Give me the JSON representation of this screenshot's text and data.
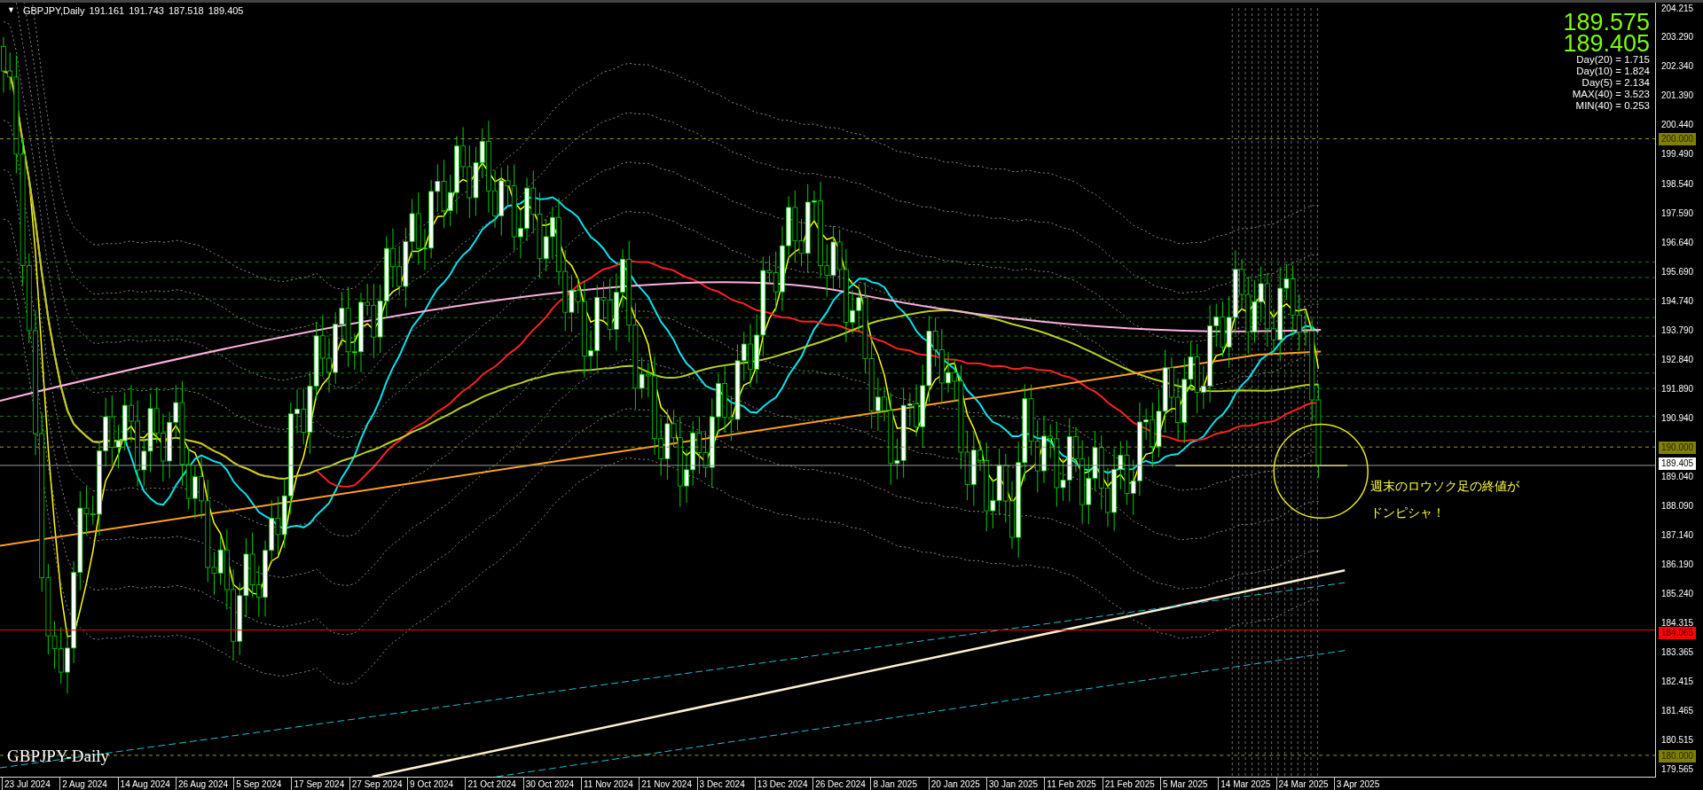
{
  "symbol_header": {
    "menu_glyph": "▼",
    "title": "GBPJPY,Daily",
    "ohlc": [
      "191.161",
      "191.743",
      "187.518",
      "189.405"
    ]
  },
  "quote_panel": {
    "prices": [
      "189.575",
      "189.405"
    ],
    "stats": [
      "Day(20) = 1.715",
      "Day(10) = 1.824",
      "Day(5) = 2.134",
      "MAX(40) = 3.523",
      "MIN(40) = 0.253"
    ]
  },
  "price_axis": {
    "ticks": [
      "204.215",
      "203.290",
      "202.340",
      "201.390",
      "200.440",
      "199.490",
      "198.540",
      "197.590",
      "196.640",
      "195.690",
      "194.740",
      "193.790",
      "192.840",
      "191.890",
      "190.940",
      "189.040",
      "188.090",
      "187.140",
      "186.190",
      "185.240",
      "184.315",
      "183.365",
      "182.415",
      "181.465",
      "180.515",
      "179.565"
    ],
    "level_tags": [
      {
        "label": "200.000",
        "kind": "level"
      },
      {
        "label": "190.000",
        "kind": "level"
      },
      {
        "label": "189.405",
        "kind": "current"
      },
      {
        "label": "184.065",
        "kind": "alert"
      },
      {
        "label": "180.000",
        "kind": "level"
      }
    ]
  },
  "time_axis": {
    "labels": [
      "23 Jul 2024",
      "2 Aug 2024",
      "14 Aug 2024",
      "26 Aug 2024",
      "5 Sep 2024",
      "17 Sep 2024",
      "27 Sep 2024",
      "9 Oct 2024",
      "21 Oct 2024",
      "30 Oct 2024",
      "11 Nov 2024",
      "21 Nov 2024",
      "3 Dec 2024",
      "13 Dec 2024",
      "26 Dec 2024",
      "8 Jan 2025",
      "20 Jan 2025",
      "30 Jan 2025",
      "11 Feb 2025",
      "21 Feb 2025",
      "5 Mar 2025",
      "14 Mar 2025",
      "24 Mar 2025",
      "3 Apr 2025"
    ]
  },
  "annotation": {
    "lines": [
      "週末のロウソク足の終値が",
      "ドンピシャ！"
    ]
  },
  "chart_label": "GBPJPY-Daily"
}
